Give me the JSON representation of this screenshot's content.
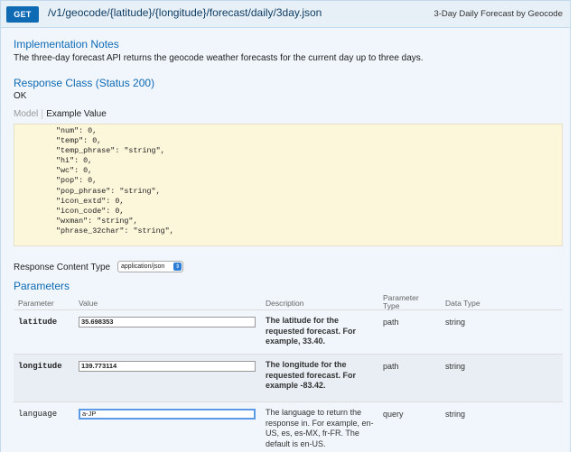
{
  "header": {
    "method": "GET",
    "path": "/v1/geocode/{latitude}/{longitude}/forecast/daily/3day.json",
    "summary": "3-Day Daily Forecast by Geocode"
  },
  "implementation": {
    "heading": "Implementation Notes",
    "text": "The three-day forecast API returns the geocode weather forecasts for the current day up to three days."
  },
  "response_class": {
    "heading": "Response Class (Status 200)",
    "status": "OK"
  },
  "tabs": {
    "model": "Model",
    "example": "Example Value"
  },
  "example_lines": [
    "\"num\": 0,",
    "\"temp\": 0,",
    "\"temp_phrase\": \"string\",",
    "\"hi\": 0,",
    "\"wc\": 0,",
    "\"pop\": 0,",
    "\"pop_phrase\": \"string\",",
    "\"icon_extd\": 0,",
    "\"icon_code\": 0,",
    "\"wxman\": \"string\",",
    "\"phrase_32char\": \"string\","
  ],
  "content_type": {
    "label": "Response Content Type",
    "value": "application/json"
  },
  "parameters": {
    "heading": "Parameters",
    "columns": {
      "parameter": "Parameter",
      "value": "Value",
      "description": "Description",
      "param_type": "Parameter Type",
      "data_type": "Data Type"
    },
    "rows": [
      {
        "name": "latitude",
        "value": "35.698353",
        "description": "The latitude for the requested forecast. For example, 33.40.",
        "param_type": "path",
        "data_type": "string"
      },
      {
        "name": "longitude",
        "value": "139.773114",
        "description": "The longitude for the requested forecast. For example -83.42.",
        "param_type": "path",
        "data_type": "string"
      },
      {
        "name": "language",
        "value": "a-JP",
        "description": "The language to return the response in. For example, en-US, es, es-MX, fr-FR. The default is en-US.",
        "param_type": "query",
        "data_type": "string"
      }
    ]
  }
}
